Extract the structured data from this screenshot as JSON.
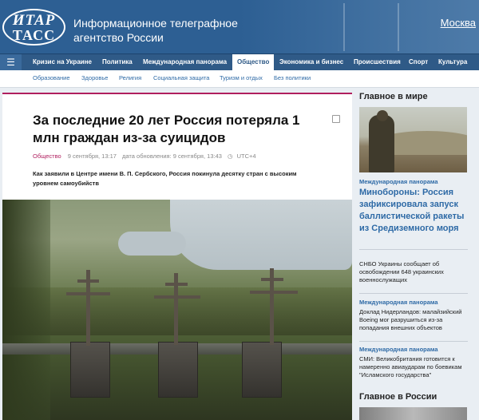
{
  "header": {
    "logo_line1": "ИТАР",
    "logo_line2": "ТАСС",
    "agency_name": "Информационное телеграфное агентство России",
    "city": "Москва"
  },
  "nav": {
    "menu_icon": "☰",
    "items": [
      {
        "label": "Кризис на Украине"
      },
      {
        "label": "Политика"
      },
      {
        "label": "Международная панорама"
      },
      {
        "label": "Общество"
      },
      {
        "label": "Экономика и бизнес"
      },
      {
        "label": "Происшествия"
      },
      {
        "label": "Спорт"
      },
      {
        "label": "Культура"
      }
    ],
    "active": "Общество"
  },
  "subnav": {
    "items": [
      {
        "label": "Образование"
      },
      {
        "label": "Здоровье"
      },
      {
        "label": "Религия"
      },
      {
        "label": "Социальная защита"
      },
      {
        "label": "Туризм и отдых"
      },
      {
        "label": "Без политики"
      }
    ]
  },
  "article": {
    "title": "За последние 20 лет Россия потеряла 1 млн граждан из-за суицидов",
    "category": "Общество",
    "date": "9 сентября, 13:17",
    "updated": "дата обновления: 9 сентября, 13:43",
    "timezone": "UTC+4",
    "lead": "Как заявили в Центре имени В. П. Сербского, Россия покинула десятку стран с высоким уровнем самоубийств"
  },
  "sidebar": {
    "world_heading": "Главное в мире",
    "news": [
      {
        "category": "Международная панорама",
        "text": "Минобороны: Россия зафиксировала запуск баллистической ракеты из Средиземного моря"
      },
      {
        "category": "",
        "text": "СНБО Украины сообщает об освобождении 648 украинских военнослужащих"
      },
      {
        "category": "Международная панорама",
        "text": "Доклад Нидерландов: малайзийский Boeing мог разрушиться из-за попадания внешних объектов"
      },
      {
        "category": "Международная панорама",
        "text": "СМИ: Великобритания готовится к намеренно авиаударам по боевикам \"Исламского государства\""
      }
    ],
    "russia_heading": "Главное в России"
  },
  "colors": {
    "header_bg": "#2d5f93",
    "nav_bg": "#2f5a87",
    "accent": "#b01f5f",
    "link": "#2e6aa6"
  },
  "icons": {
    "menu": "menu-icon",
    "print": "print-icon",
    "clock": "clock-icon"
  }
}
